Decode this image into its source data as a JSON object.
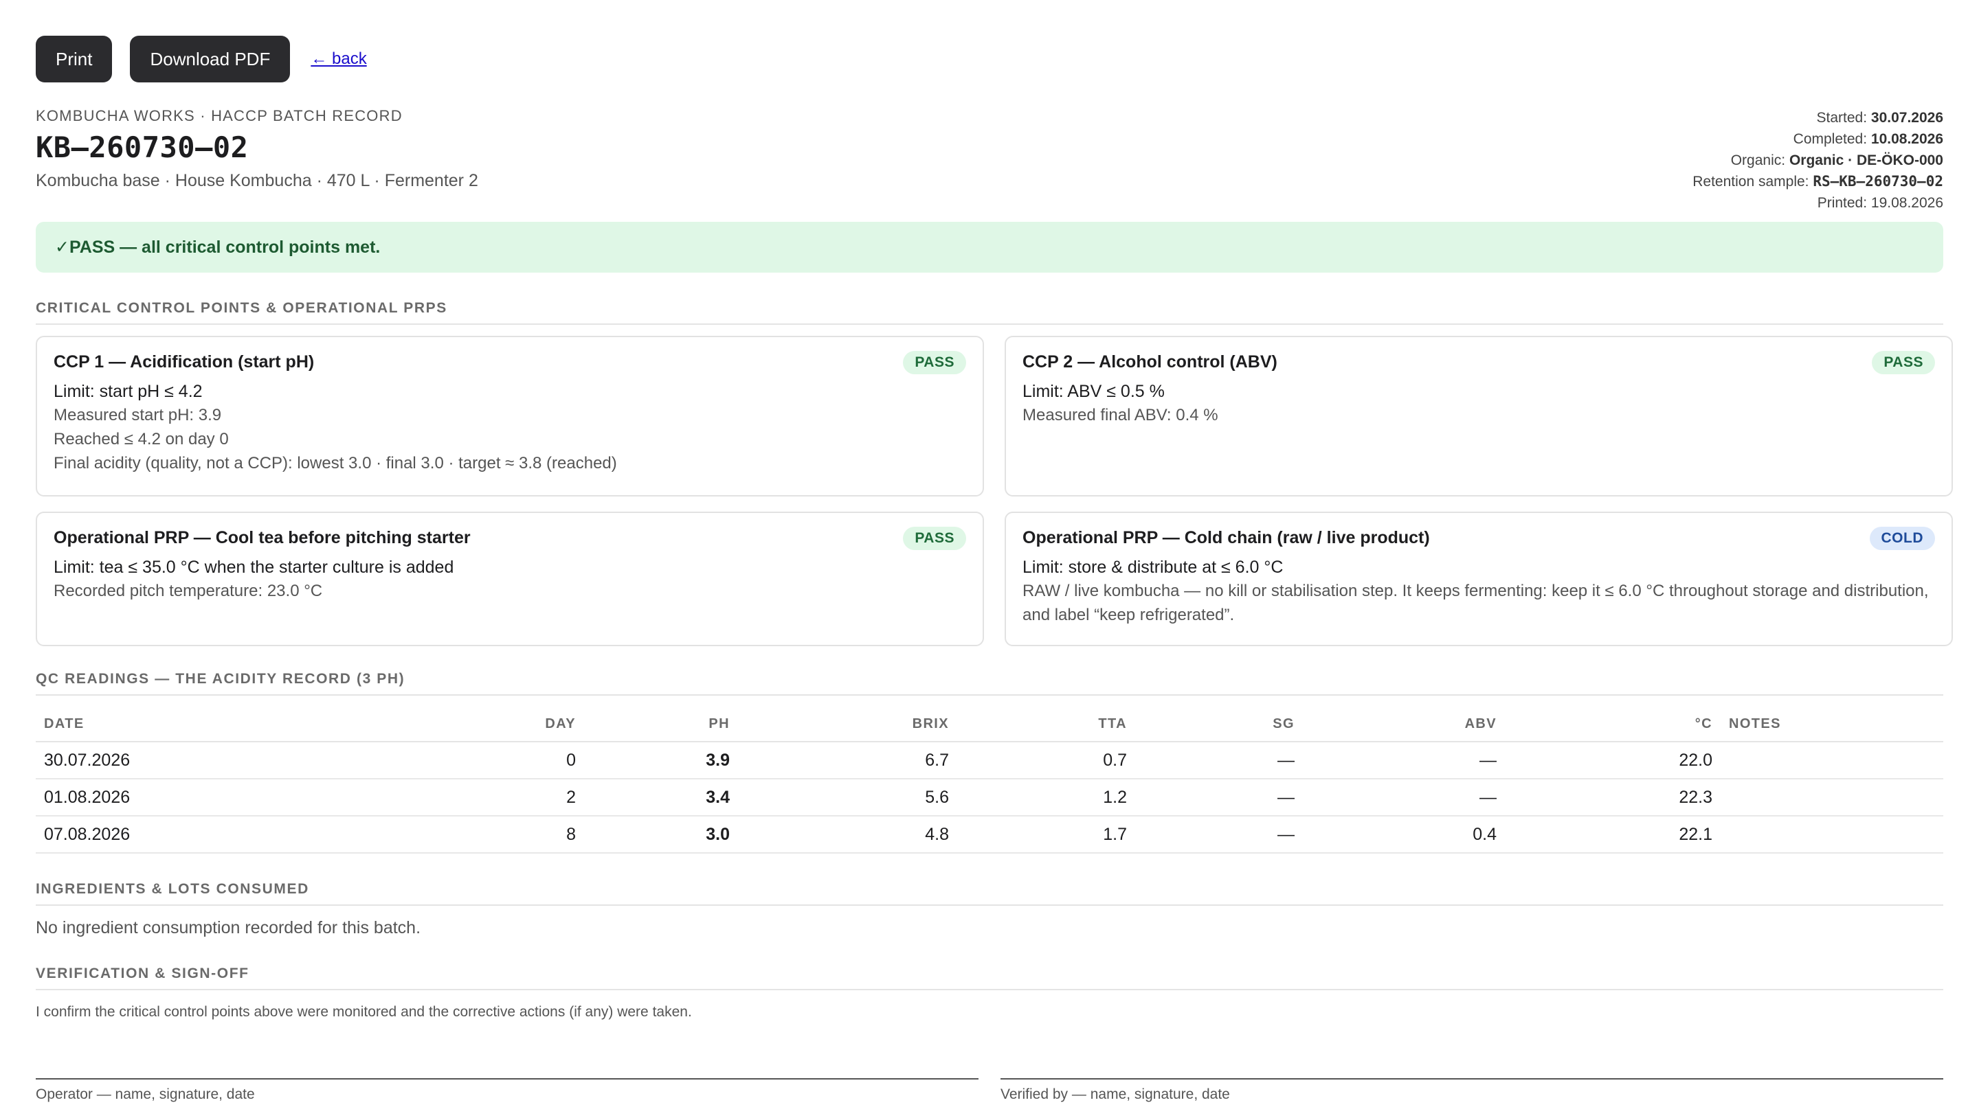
{
  "toolbar": {
    "print_label": "Print",
    "download_label": "Download PDF",
    "back_label": "← back"
  },
  "header": {
    "eyebrow": "KOMBUCHA WORKS · HACCP BATCH RECORD",
    "batch_id": "KB–260730–02",
    "subtitle": "Kombucha base · House Kombucha · 470 L · Fermenter 2",
    "meta": {
      "started_label": "Started:",
      "started": "30.07.2026",
      "completed_label": "Completed:",
      "completed": "10.08.2026",
      "organic_label": "Organic:",
      "organic": "Organic · DE-ÖKO-000",
      "retention_label": "Retention sample:",
      "retention": "RS–KB–260730–02",
      "printed": "Printed: 19.08.2026"
    }
  },
  "banner": {
    "text": "✓PASS — all critical control points met."
  },
  "ccp_section": {
    "title": "CRITICAL CONTROL POINTS & OPERATIONAL PRPS",
    "cards": [
      {
        "title": "CCP 1 — Acidification (start pH)",
        "badge": "PASS",
        "limit": "Limit: start pH ≤ 4.2",
        "lines": [
          "Measured start pH: 3.9",
          "Reached ≤ 4.2 on day 0",
          "Final acidity (quality, not a CCP): lowest 3.0 · final 3.0 · target ≈ 3.8 (reached)"
        ]
      },
      {
        "title": "CCP 2 — Alcohol control (ABV)",
        "badge": "PASS",
        "limit": "Limit: ABV ≤ 0.5 %",
        "lines": [
          "Measured final ABV: 0.4 %"
        ]
      },
      {
        "title": "Operational PRP — Cool tea before pitching starter",
        "badge": "PASS",
        "limit": "Limit: tea ≤ 35.0 °C when the starter culture is added",
        "lines": [
          "Recorded pitch temperature: 23.0 °C"
        ]
      },
      {
        "title": "Operational PRP — Cold chain (raw / live product)",
        "badge": "COLD",
        "limit": "Limit: store & distribute at ≤ 6.0 °C",
        "lines": [
          "RAW / live kombucha — no kill or stabilisation step. It keeps fermenting: keep it ≤ 6.0 °C throughout storage and distribution, and label “keep refrigerated”."
        ]
      }
    ]
  },
  "qc_section": {
    "title": "QC READINGS — THE ACIDITY RECORD (3 PH)",
    "columns": [
      "DATE",
      "DAY",
      "PH",
      "BRIX",
      "TTA",
      "SG",
      "ABV",
      "°C",
      "NOTES"
    ],
    "rows": [
      [
        "30.07.2026",
        "0",
        "3.9",
        "6.7",
        "0.7",
        "—",
        "—",
        "22.0",
        ""
      ],
      [
        "01.08.2026",
        "2",
        "3.4",
        "5.6",
        "1.2",
        "—",
        "—",
        "22.3",
        ""
      ],
      [
        "07.08.2026",
        "8",
        "3.0",
        "4.8",
        "1.7",
        "—",
        "0.4",
        "22.1",
        ""
      ]
    ]
  },
  "ingredients_section": {
    "title": "INGREDIENTS & LOTS CONSUMED",
    "note": "No ingredient consumption recorded for this batch."
  },
  "verification_section": {
    "title": "VERIFICATION & SIGN-OFF",
    "statement": "I confirm the critical control points above were monitored and the corrective actions (if any) were taken.",
    "operator_label": "Operator — name, signature, date",
    "verifier_label": "Verified by — name, signature, date"
  },
  "colors": {
    "pass_bg": "#dff7e6",
    "pass_text": "#1f6b3a",
    "cold_bg": "#dde9fb",
    "cold_text": "#1f4c9a",
    "button_bg": "#2b2b2e"
  }
}
